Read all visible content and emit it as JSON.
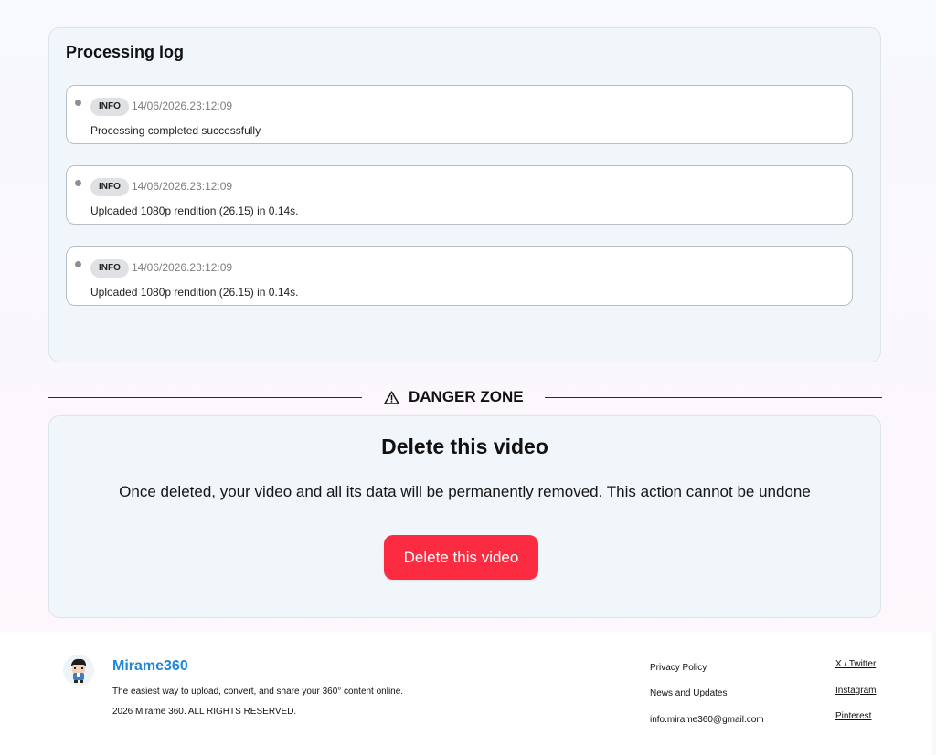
{
  "processing_log": {
    "title": "Processing log",
    "entries": [
      {
        "level": "INFO",
        "timestamp": "14/06/2026.23:12:09",
        "message": "Processing completed successfully"
      },
      {
        "level": "INFO",
        "timestamp": "14/06/2026.23:12:09",
        "message": "Uploaded 1080p rendition (26.15) in 0.14s."
      },
      {
        "level": "INFO",
        "timestamp": "14/06/2026.23:12:09",
        "message": "Uploaded 1080p rendition (26.15) in 0.14s."
      }
    ]
  },
  "danger_zone": {
    "label": "DANGER ZONE",
    "icon": "warning-icon",
    "title": "Delete this video",
    "description": "Once deleted, your video and all its data will be permanently removed. This action cannot be undone",
    "button_label": "Delete this video",
    "button_color": "#fb2c42"
  },
  "footer": {
    "brand": "Mirame360",
    "brand_color": "#1f87d6",
    "tagline": "The easiest way to upload, convert, and share your 360° content online.",
    "copyright": "2026 Mirame 360. ALL RIGHTS RESERVED.",
    "links": [
      "Privacy Policy",
      "News and Updates",
      "info.mirame360@gmail.com"
    ],
    "social": [
      "X / Twitter",
      "Instagram",
      "Pinterest"
    ]
  }
}
